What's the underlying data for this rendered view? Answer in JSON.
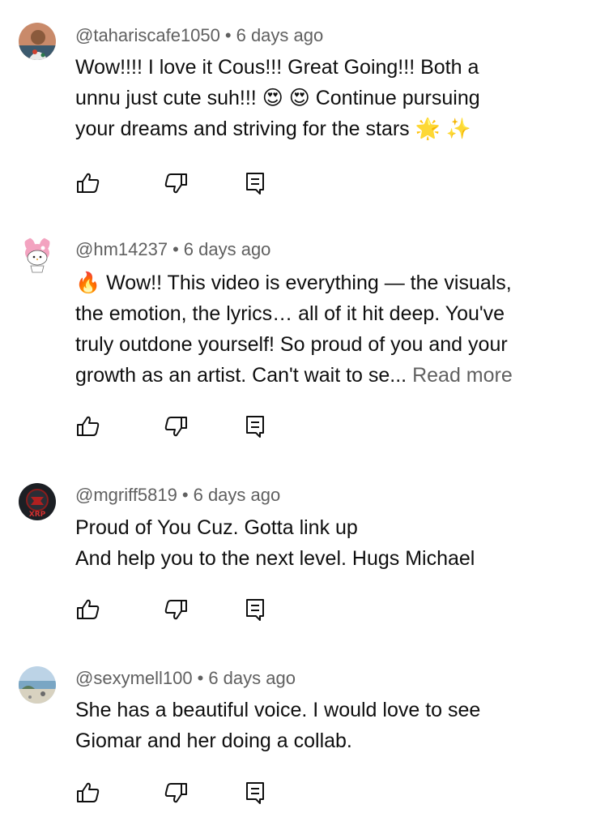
{
  "comments": [
    {
      "username": "@tahariscafe1050",
      "time": "6 days ago",
      "lines": [
        "Wow!!!! I love it Cous!!! Great Going!!! Both a",
        "unnu just cute suh!!! 😍 😍 Continue pursuing",
        "your dreams and striving for the stars 🌟 ✨"
      ],
      "read_more": "",
      "avatar_icon": "person-photo-avatar"
    },
    {
      "username": "@hm14237",
      "time": "6 days ago",
      "lines": [
        "🔥 Wow!! This video is everything — the visuals,",
        "the emotion, the lyrics… all of it hit deep. You've",
        "truly outdone yourself! So proud of you and your",
        "growth as an artist. Can't wait to se..."
      ],
      "read_more": "Read more",
      "avatar_icon": "my-melody-avatar"
    },
    {
      "username": "@mgriff5819",
      "time": "6 days ago",
      "lines": [
        "Proud of You Cuz. Gotta link up",
        "And help you to the next level. Hugs Michael"
      ],
      "read_more": "",
      "avatar_icon": "xrp-logo-avatar"
    },
    {
      "username": "@sexymell100",
      "time": "6 days ago",
      "lines": [
        "She has a beautiful voice. I would love to see",
        "Giomar and her doing a collab."
      ],
      "read_more": "",
      "avatar_icon": "beach-photo-avatar"
    }
  ],
  "actions": {
    "like_icon": "thumbs-up-icon",
    "dislike_icon": "thumbs-down-icon",
    "reply_icon": "reply-comment-icon"
  },
  "colors": {
    "text": "#0f0f0f",
    "secondary": "#606060",
    "background": "#ffffff"
  }
}
